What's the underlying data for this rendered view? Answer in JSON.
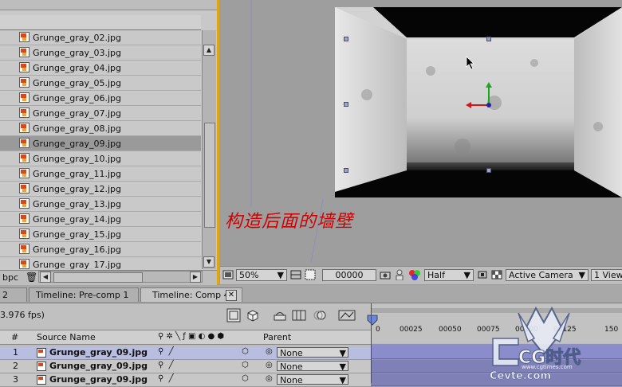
{
  "project": {
    "files": [
      "Grunge_gray_02.jpg",
      "Grunge_gray_03.jpg",
      "Grunge_gray_04.jpg",
      "Grunge_gray_05.jpg",
      "Grunge_gray_06.jpg",
      "Grunge_gray_07.jpg",
      "Grunge_gray_08.jpg",
      "Grunge_gray_09.jpg",
      "Grunge_gray_10.jpg",
      "Grunge_gray_11.jpg",
      "Grunge_gray_12.jpg",
      "Grunge_gray_13.jpg",
      "Grunge_gray_14.jpg",
      "Grunge_gray_15.jpg",
      "Grunge_gray_16.jpg",
      "Grunge_gray_17.jpg"
    ],
    "selected_file": "Grunge_gray_09.jpg",
    "bpc_label": "bpc"
  },
  "composition": {
    "caption": "构造后面的墙壁",
    "zoom": "50%",
    "timecode": "00000",
    "resolution": "Half",
    "camera": "Active Camera",
    "views": "1 View"
  },
  "timeline": {
    "tabs": [
      "2",
      "Timeline: Pre-comp 1",
      "Timeline: Comp 4"
    ],
    "fps": "3.976 fps)",
    "columns": {
      "hash": "#",
      "source_name": "Source Name",
      "parent": "Parent"
    },
    "layers": [
      {
        "num": "1",
        "name": "Grunge_gray_09.jpg",
        "parent": "None"
      },
      {
        "num": "2",
        "name": "Grunge_gray_09.jpg",
        "parent": "None"
      },
      {
        "num": "3",
        "name": "Grunge_gray_09.jpg",
        "parent": "None"
      }
    ],
    "ruler_ticks": [
      "0",
      "00025",
      "00050",
      "00075",
      "00100",
      "00125",
      "150"
    ]
  },
  "watermark": {
    "text_main": "CG时代",
    "text_url": "www.cgtimes.com",
    "text_side": "Cevte.com"
  },
  "colors": {
    "panel_border_accent": "#e0a414",
    "caption_red": "#d00000",
    "playhead": "#dd1111",
    "layer_bar": "#7f81b6"
  }
}
